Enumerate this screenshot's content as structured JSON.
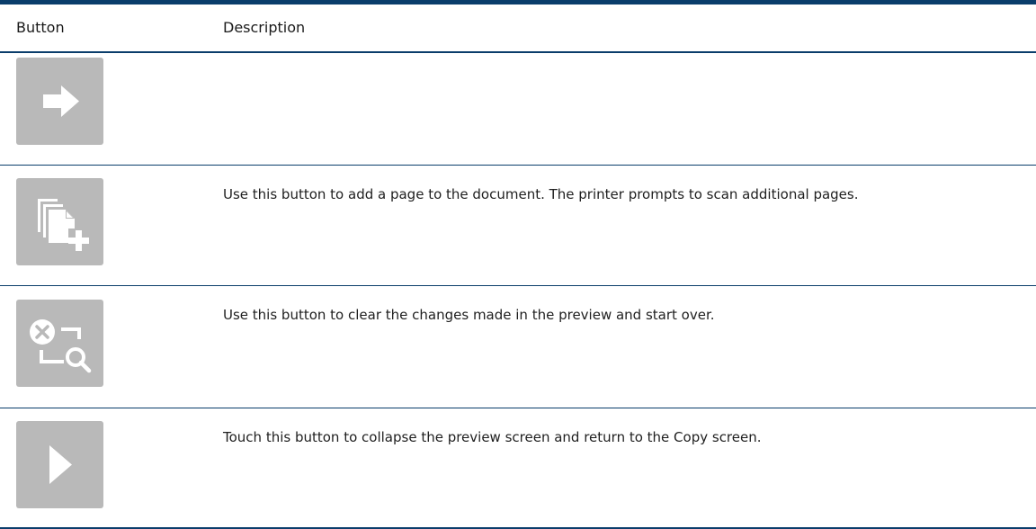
{
  "table": {
    "headers": {
      "button": "Button",
      "description": "Description"
    },
    "rows": [
      {
        "icon": "arrow-right-icon",
        "description": ""
      },
      {
        "icon": "add-page-icon",
        "description": "Use this button to add a page to the document. The printer prompts to scan additional pages."
      },
      {
        "icon": "clear-preview-icon",
        "description": "Use this button to clear the changes made in the preview and start over."
      },
      {
        "icon": "collapse-preview-icon",
        "description": "Touch this button to collapse the preview screen and return to the Copy screen."
      }
    ]
  },
  "colors": {
    "rule": "#0a3d6b",
    "tile": "#b9b9b9",
    "icon": "#ffffff"
  }
}
